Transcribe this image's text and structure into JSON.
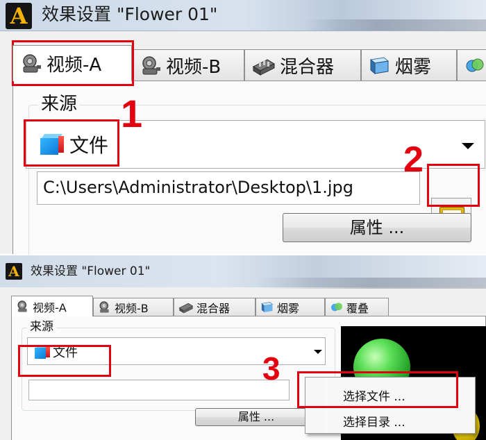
{
  "window": {
    "title": "效果设置 \"Flower 01\"",
    "logo_letter": "A"
  },
  "tabs": [
    {
      "label": "视频-A",
      "icon": "camera-icon"
    },
    {
      "label": "视频-B",
      "icon": "camera-icon"
    },
    {
      "label": "混合器",
      "icon": "mixer-icon"
    },
    {
      "label": "烟雾",
      "icon": "fog-icon"
    },
    {
      "label": "覆叠",
      "icon": "overlay-icon"
    }
  ],
  "source": {
    "group_label": "来源",
    "selected": "文件",
    "path": "C:\\Users\\Administrator\\Desktop\\1.jpg",
    "path_empty": "",
    "properties_label": "属性 ..."
  },
  "context_menu": {
    "items": [
      "选择文件 ...",
      "选择目录 ..."
    ]
  },
  "callouts": [
    "1",
    "2",
    "3"
  ],
  "colors": {
    "highlight": "#e3000f",
    "preview_background": "#000000",
    "preview_object": "#38c93c"
  }
}
